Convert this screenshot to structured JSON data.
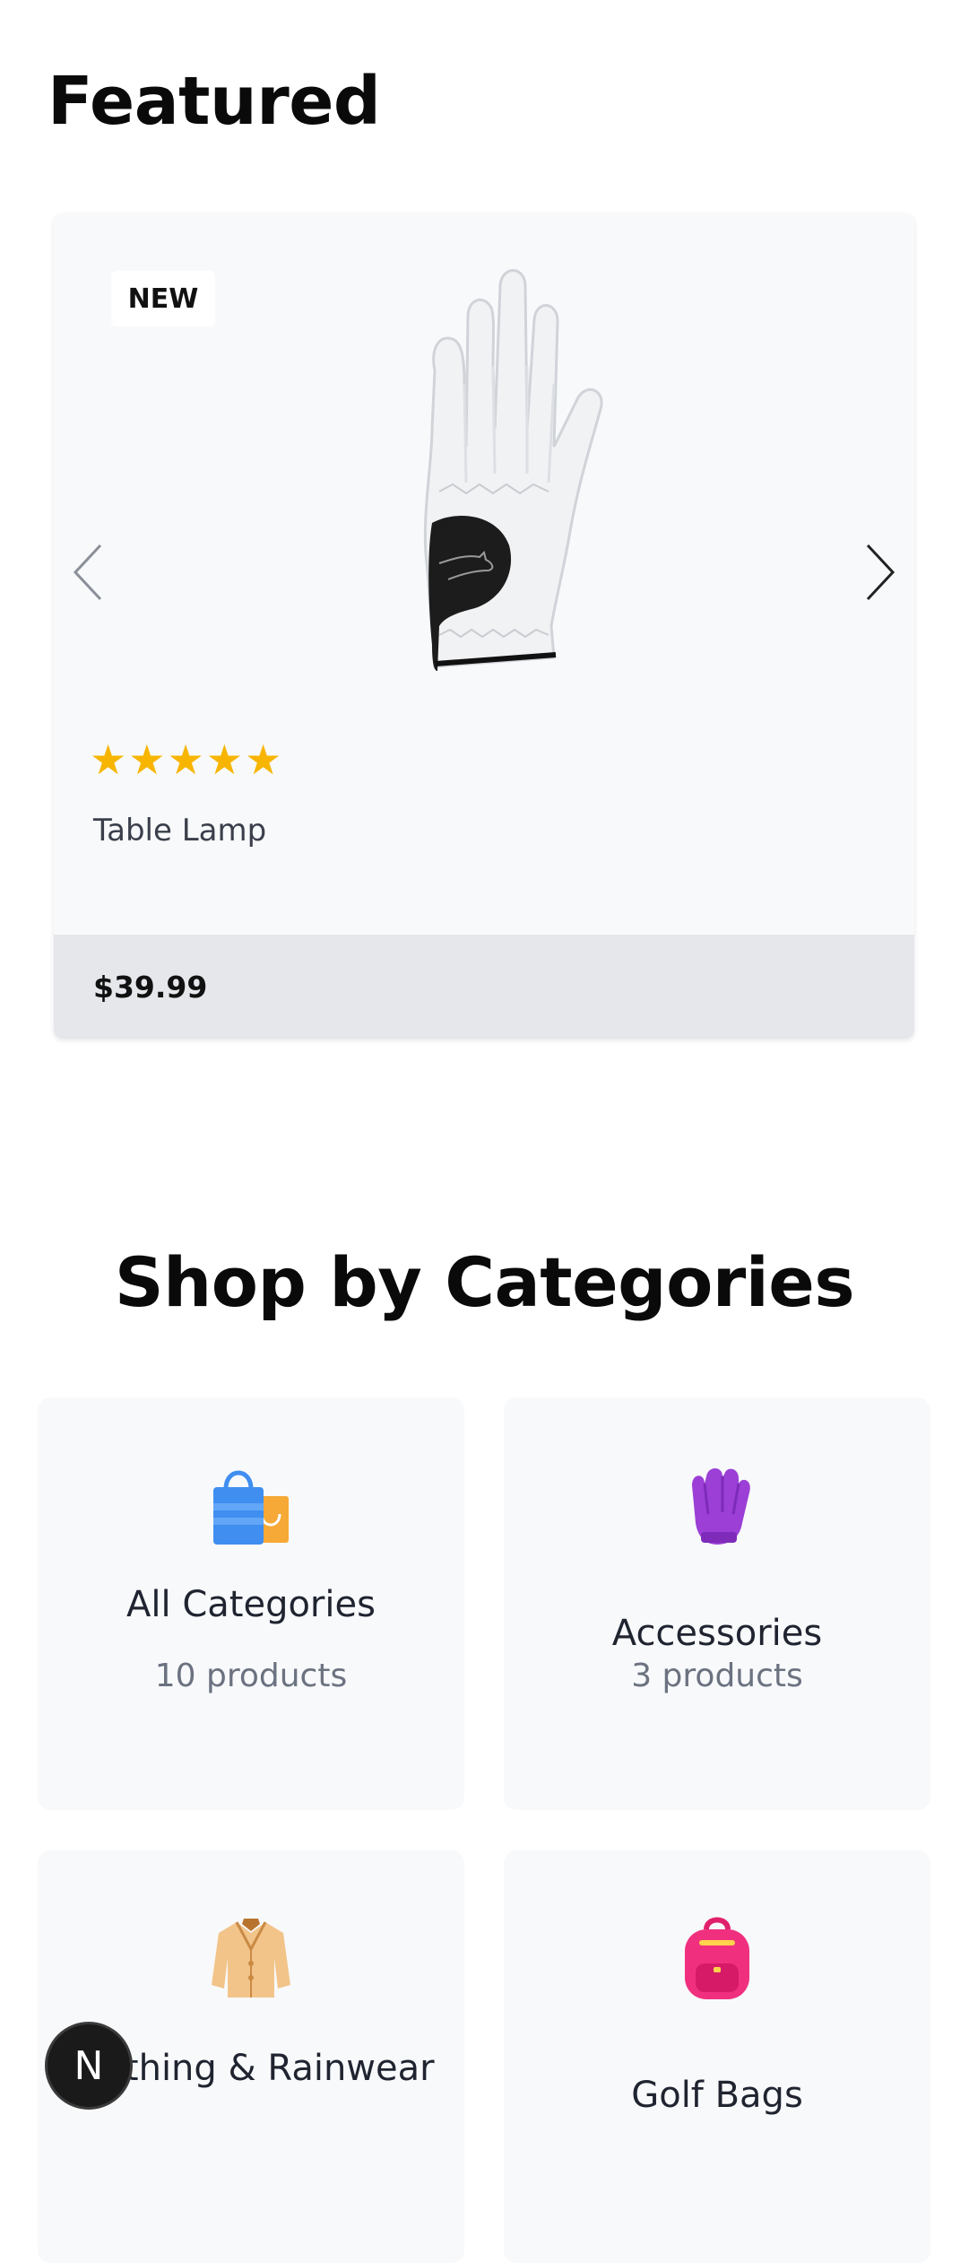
{
  "featured": {
    "title": "Featured",
    "product": {
      "badge": "NEW",
      "rating": 5,
      "name": "Table Lamp",
      "price": "$39.99",
      "image_icon": "golf-glove-image"
    },
    "nav": {
      "prev_icon": "chevron-left-icon",
      "next_icon": "chevron-right-icon"
    }
  },
  "categories": {
    "title": "Shop by Categories",
    "items": [
      {
        "name": "All Categories",
        "count": "10 products",
        "icon": "shopping-bags-icon"
      },
      {
        "name": "Accessories",
        "count": "3 products",
        "icon": "glove-icon"
      },
      {
        "name": "Clothing & Rainwear",
        "count": "",
        "icon": "coat-icon"
      },
      {
        "name": "Golf Bags",
        "count": "",
        "icon": "backpack-icon"
      }
    ]
  },
  "floating_button": {
    "label": "N"
  },
  "colors": {
    "star": "#f7b500",
    "price_bar": "#e5e7eb",
    "card_bg": "#f8f9fb"
  }
}
